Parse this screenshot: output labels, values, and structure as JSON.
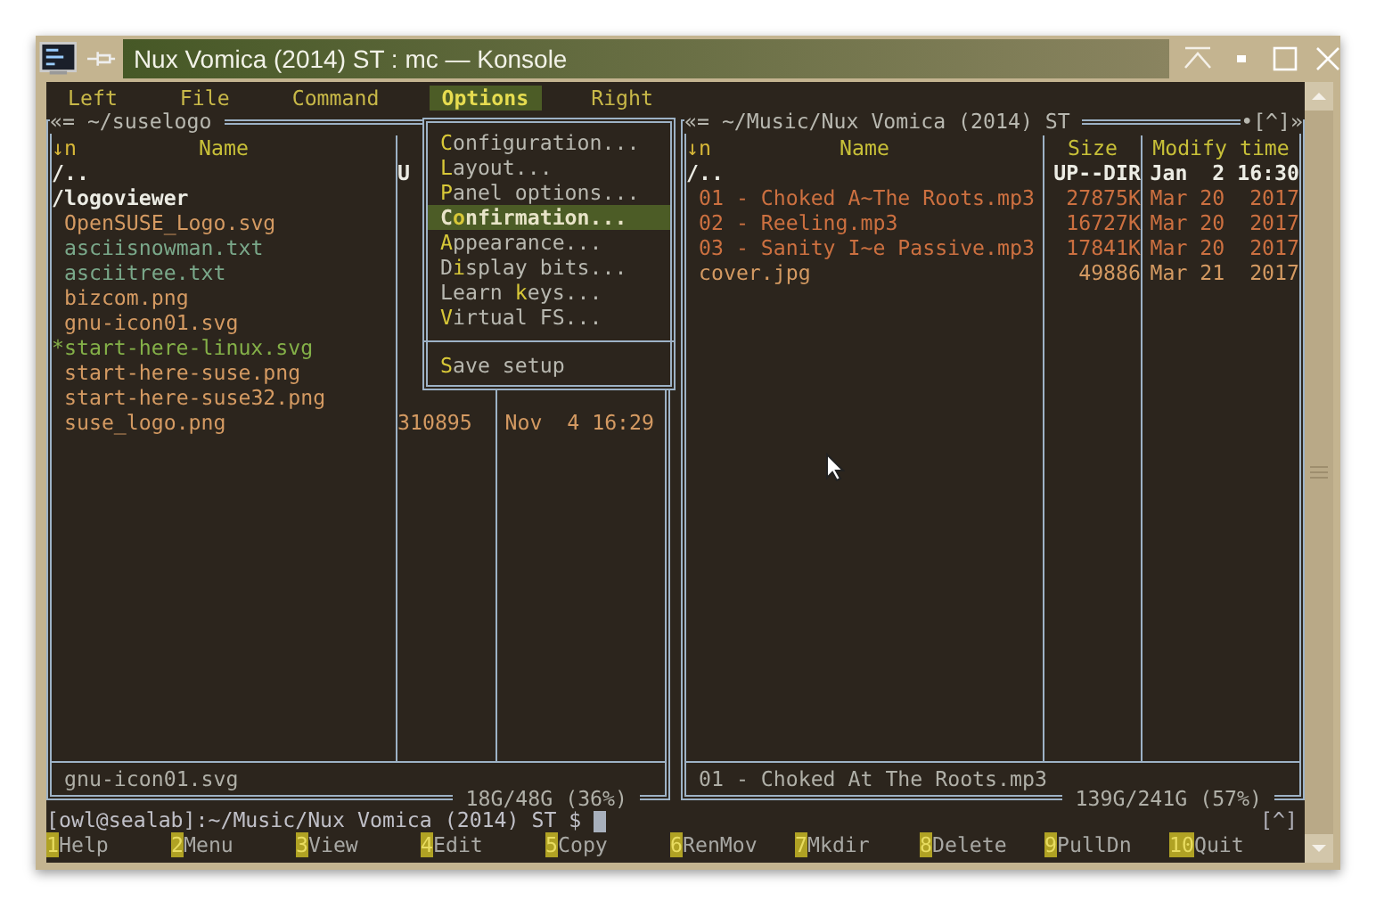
{
  "window": {
    "title": "Nux Vomica (2014) ST : mc — Konsole"
  },
  "menu_bar": [
    {
      "label": "Left",
      "selected": false
    },
    {
      "label": "File",
      "selected": false
    },
    {
      "label": "Command",
      "selected": false
    },
    {
      "label": "Options",
      "selected": true
    },
    {
      "label": "Right",
      "selected": false
    }
  ],
  "options_menu": [
    {
      "hotkey": "C",
      "after": "onfiguration...",
      "selected": false
    },
    {
      "hotkey": "L",
      "after": "ayout...",
      "selected": false
    },
    {
      "hotkey": "P",
      "after": "anel options...",
      "selected": false
    },
    {
      "before": "C",
      "hotkey": "o",
      "after": "nfirmation...",
      "selected": true
    },
    {
      "hotkey": "A",
      "after": "ppearance...",
      "selected": false
    },
    {
      "before": "D",
      "hotkey": "i",
      "after": "splay bits...",
      "selected": false
    },
    {
      "before": "Learn ",
      "hotkey": "k",
      "after": "eys...",
      "selected": false
    },
    {
      "hotkey": "V",
      "after": "irtual FS...",
      "selected": false
    },
    {
      "kind": "separator"
    },
    {
      "hotkey": "S",
      "after": "ave setup",
      "selected": false
    }
  ],
  "left_panel": {
    "path": "«= ~/suselogo",
    "sort": "↓n",
    "columns": [
      "Name"
    ],
    "rows": [
      {
        "name": "/..",
        "kind": "dir",
        "size": "U"
      },
      {
        "name": "/logoviewer",
        "kind": "dir"
      },
      {
        "name": "OpenSUSE_Logo.svg",
        "kind": "image"
      },
      {
        "name": "asciisnowman.txt",
        "kind": "text"
      },
      {
        "name": "asciitree.txt",
        "kind": "text"
      },
      {
        "name": "bizcom.png",
        "kind": "image"
      },
      {
        "name": "gnu-icon01.svg",
        "kind": "image"
      },
      {
        "name": "*start-here-linux.svg",
        "kind": "executable"
      },
      {
        "name": "start-here-suse.png",
        "kind": "image"
      },
      {
        "name": "start-here-suse32.png",
        "kind": "image"
      },
      {
        "name": "suse_logo.png",
        "kind": "image",
        "size": "310895",
        "time": "Nov  4 16:29"
      }
    ],
    "mini_status": "gnu-icon01.svg",
    "disk": "18G/48G (36%)"
  },
  "right_panel": {
    "path": "«= ~/Music/Nux Vomica (2014) ST",
    "corner": "•[^]»",
    "sort": "↓n",
    "columns": [
      "Name",
      "Size",
      "Modify time"
    ],
    "rows": [
      {
        "name": "/..",
        "kind": "dir",
        "size": "UP--DIR",
        "time": "Jan  2 16:30"
      },
      {
        "name": "01 - Choked A~The Roots.mp3",
        "kind": "media",
        "size": "27875K",
        "time": "Mar 20  2017"
      },
      {
        "name": "02 - Reeling.mp3",
        "kind": "media",
        "size": "16727K",
        "time": "Mar 20  2017"
      },
      {
        "name": "03 - Sanity I~e Passive.mp3",
        "kind": "media",
        "size": "17841K",
        "time": "Mar 20  2017"
      },
      {
        "name": "cover.jpg",
        "kind": "image",
        "size": "49886",
        "time": "Mar 21  2017"
      }
    ],
    "mini_status": "01 - Choked At The Roots.mp3",
    "disk": "139G/241G (57%)"
  },
  "command_line": {
    "prompt": "[owl@sealab]:~/Music/Nux Vomica (2014) ST $",
    "hint": "[^]"
  },
  "function_keys": [
    {
      "key": "1",
      "label": "Help"
    },
    {
      "key": "2",
      "label": "Menu"
    },
    {
      "key": "3",
      "label": "View"
    },
    {
      "key": "4",
      "label": "Edit"
    },
    {
      "key": "5",
      "label": "Copy"
    },
    {
      "key": "6",
      "label": "RenMov"
    },
    {
      "key": "7",
      "label": "Mkdir"
    },
    {
      "key": "8",
      "label": "Delete"
    },
    {
      "key": "9",
      "label": "PullDn"
    },
    {
      "key": "10",
      "label": "Quit"
    }
  ]
}
